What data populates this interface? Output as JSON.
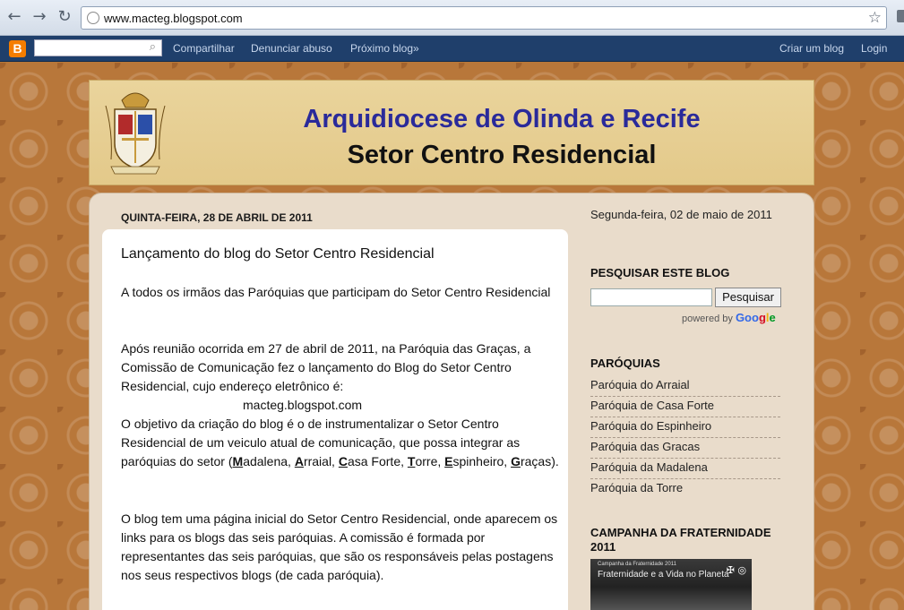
{
  "browser": {
    "url": "www.macteg.blogspot.com",
    "back_icon": "←",
    "forward_icon": "→",
    "reload_icon": "↻",
    "star_icon": "☆"
  },
  "navbar": {
    "logo_letter": "B",
    "search_icon": "⌕",
    "links_left": [
      "Compartilhar",
      "Denunciar abuso",
      "Próximo blog»"
    ],
    "links_right": [
      "Criar um blog",
      "Login"
    ]
  },
  "header": {
    "title": "Arquidiocese de Olinda e Recife",
    "subtitle": "Setor Centro Residencial",
    "crest_caption": "ARQUIDIOCESE DE OLINDA E RECIFE"
  },
  "post": {
    "date_header": "QUINTA-FEIRA, 28 DE ABRIL DE 2011",
    "title": "Lançamento do blog do Setor Centro Residencial",
    "para1": "A todos os irmãos das Paróquias que participam  do Setor Centro Residencial",
    "para2": "Após reunião ocorrida em 27 de abril de 2011, na Paróquia das Graças, a Comissão de Comunicação fez o lançamento do Blog do Setor Centro Residencial, cujo endereço eletrônico é:",
    "blog_address": "macteg.blogspot.com",
    "para3_start": "O objetivo da criação do blog é o de instrumentalizar o Setor Centro Residencial de um veiculo atual de comunicação, que possa integrar as paróquias do setor (",
    "parishes_abbrev": [
      {
        "initial": "M",
        "rest": "adalena, "
      },
      {
        "initial": "A",
        "rest": "rraial, "
      },
      {
        "initial": "C",
        "rest": "asa Forte, "
      },
      {
        "initial": "T",
        "rest": "orre, "
      },
      {
        "initial": "E",
        "rest": "spinheiro, "
      },
      {
        "initial": "G",
        "rest": "raças)."
      }
    ],
    "para4": "O blog tem uma página inicial do Setor Centro Residencial, onde aparecem os links para os blogs das seis paróquias. A comissão é formada por representantes das seis paróquias, que são os responsáveis pelas postagens nos seus respectivos blogs (de cada paróquia)."
  },
  "sidebar": {
    "date": "Segunda-feira, 02 de maio de 2011",
    "search_heading": "PESQUISAR ESTE BLOG",
    "search_button": "Pesquisar",
    "powered_by": "powered by",
    "google_letters": [
      "Goo",
      "g",
      "l",
      "e"
    ],
    "parishes_heading": "PARÓQUIAS",
    "parishes": [
      "Paróquia do Arraial",
      "Paróquia de Casa Forte",
      "Paróquia do Espinheiro",
      "Paróquia das Gracas",
      "Paróquia da Madalena",
      "Paróquia da Torre"
    ],
    "campanha_heading": "CAMPANHA DA FRATERNIDADE 2011",
    "campanha_small": "Campanha da Fraternidade 2011",
    "campanha_title": "Fraternidade e a Vida no Planeta"
  },
  "colors": {
    "navbar_bg": "#1f3f6b",
    "header_title": "#2a2a9a",
    "page_bg": "#b8773a",
    "content_bg": "#e9dccb"
  }
}
